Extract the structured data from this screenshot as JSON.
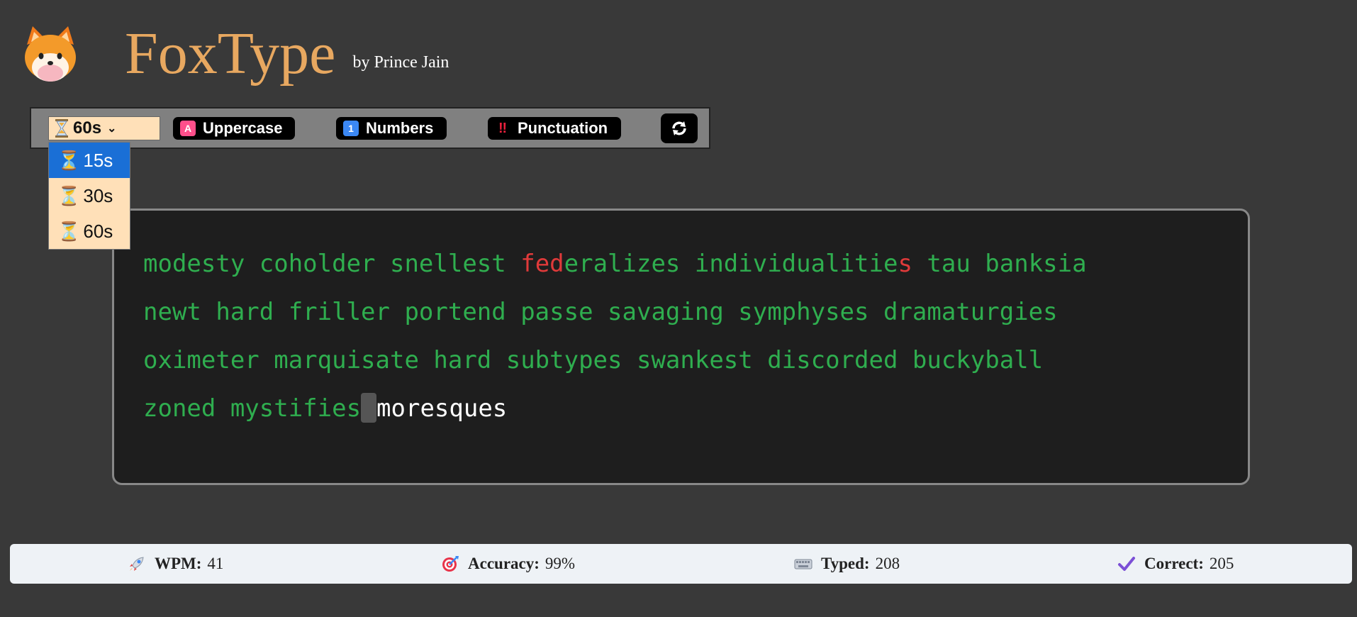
{
  "header": {
    "title": "FoxType",
    "byline": "by Prince Jain",
    "logo_icon": "fox-face-icon"
  },
  "toolbar": {
    "time_select": {
      "icon": "hourglass-icon",
      "value": "60s"
    },
    "uppercase": {
      "icon": "letter-a-icon",
      "glyph": "A",
      "label": "Uppercase",
      "color": "#ff4f8b"
    },
    "numbers": {
      "icon": "keycap-one-icon",
      "glyph": "1",
      "label": "Numbers",
      "color": "#3b88f5"
    },
    "punctuation": {
      "icon": "double-exclamation-icon",
      "glyph": "‼",
      "label": "Punctuation",
      "color": "#e8203c"
    },
    "reset": {
      "icon": "refresh-icon"
    }
  },
  "dropdown": {
    "options": [
      {
        "label": "15s",
        "selected": true
      },
      {
        "label": "30s",
        "selected": false
      },
      {
        "label": "60s",
        "selected": false
      }
    ]
  },
  "typing": {
    "line1": {
      "a": "modesty coholder snellest ",
      "b": "fed",
      "c": "eralizes individualitie",
      "d": "s",
      "e": " tau banksia"
    },
    "line2": "newt hard friller portend passe savaging symphyses dramaturgies",
    "line3": "oximeter marquisate hard subtypes swankest discorded buckyball",
    "line4": {
      "typed": "zoned mystifies",
      "pending": "moresques"
    },
    "colors": {
      "correct": "#2fae4f",
      "incorrect": "#e03a3a",
      "pending": "#ffffff"
    }
  },
  "stats": {
    "wpm": {
      "icon": "rocket-icon",
      "label": "WPM:",
      "value": "41"
    },
    "accuracy": {
      "icon": "target-icon",
      "label": "Accuracy:",
      "value": "99%"
    },
    "typed": {
      "icon": "keyboard-icon",
      "label": "Typed:",
      "value": "208"
    },
    "correct": {
      "icon": "checkmark-icon",
      "label": "Correct:",
      "value": "205"
    }
  }
}
